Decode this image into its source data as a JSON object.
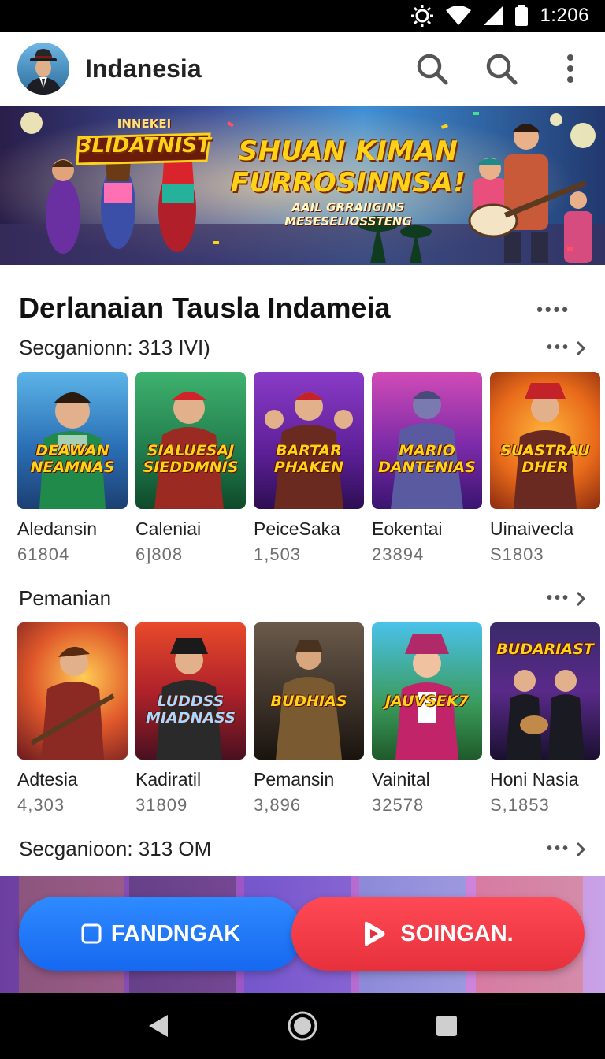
{
  "status_bar": {
    "time": "1:206"
  },
  "app_bar": {
    "title": "Indanesia"
  },
  "banner": {
    "headline_line1": "SHUAN KIMAN",
    "headline_line2": "FURROSINNSA!",
    "subline": "AAIL GRRAIIGINS MESESELIOSSTENG",
    "logo_text": "3LIDATNIST",
    "logo_top_text": "INNEKEI"
  },
  "content": {
    "title": "Derlanaian Tausla Indameia",
    "more": "••••",
    "sections": [
      {
        "title": "Secganionn: 313 IVI)",
        "cards": [
          {
            "title": "Aledansin",
            "count": "61804",
            "art": "DEAWAN NEAMNAS"
          },
          {
            "title": "Caleniai",
            "count": "6]808",
            "art": "SIALUESAJ SIEDDMNIS"
          },
          {
            "title": "PeiceSaka",
            "count": "1,503",
            "art": "BARTAR PHAKEN"
          },
          {
            "title": "Eokentai",
            "count": "23894",
            "art": "MARIO DANTENIAS"
          },
          {
            "title": "Uinaivecla",
            "count": "S1803",
            "art": "SUASTRAU DHER"
          }
        ]
      },
      {
        "title": "Pemanian",
        "cards": [
          {
            "title": "Adtesia",
            "count": "4,303",
            "art": ""
          },
          {
            "title": "Kadiratil",
            "count": "31809",
            "art": "LUDDSS MIADNASS"
          },
          {
            "title": "Pemansin",
            "count": "3,896",
            "art": "BUDHIAS"
          },
          {
            "title": "Vainital",
            "count": "32578",
            "art": "JAUVSEK7"
          },
          {
            "title": "Honi Nasia",
            "count": "S,1853",
            "art": "BUDARIAST"
          }
        ]
      },
      {
        "title": "Secganioon: 313 OM",
        "cards": []
      }
    ]
  },
  "action_bar": {
    "primary_label": "FANDNGAK",
    "secondary_label": "SOINGAN."
  },
  "colors": {
    "primary_button": "#1f78ff",
    "secondary_button": "#f03a45",
    "banner_text": "#ffd21a"
  }
}
